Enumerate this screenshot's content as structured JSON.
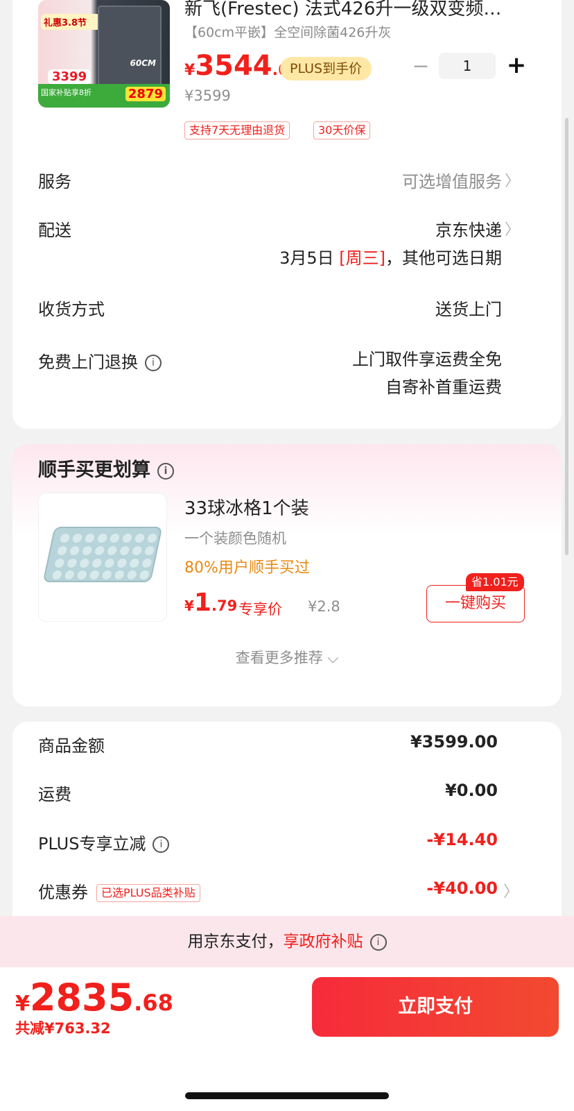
{
  "product": {
    "title": "新飞(Frestec) 法式426升一级双变频…",
    "subtitle": "【60cm平嵌】全空间除菌426升灰",
    "image": {
      "promo_text": "礼惠3.8节",
      "promo_price": "3399",
      "size_text": "60CM",
      "band_text": "国家补贴享8折",
      "band_price": "2879"
    },
    "price_yen": "¥",
    "price_int": "3544",
    "price_dec": ".6",
    "plus_label": "PLUS到手价",
    "orig_price": "¥3599",
    "quantity": "1",
    "minus": "−",
    "plus": "+",
    "badges": [
      "支持7天无理由退货",
      "30天价保"
    ]
  },
  "rows": {
    "service": {
      "label": "服务",
      "value": "可选增值服务"
    },
    "delivery": {
      "label": "配送",
      "value": "京东快递",
      "date_prefix": "3月5日 ",
      "date_day": "[周三]",
      "date_suffix": "，其他可选日期"
    },
    "receive": {
      "label": "收货方式",
      "value": "送货上门"
    },
    "return": {
      "label": "免费上门退换",
      "line1": "上门取件享运费全免",
      "line2": "自寄补首重运费"
    }
  },
  "recommend": {
    "title": "顺手买更划算",
    "item_title": "33球冰格1个装",
    "item_sub": "一个装颜色随机",
    "bought": "80%用户顺手买过",
    "price_yen": "¥",
    "price_int": "1",
    "price_dec": ".79",
    "price_label": "专享价",
    "orig_price": "¥2.8",
    "save_tag": "省1.01元",
    "buy_label": "一键购买",
    "more_label": "查看更多推荐 ⌵"
  },
  "summary": {
    "goods": {
      "label": "商品金额",
      "value": "¥3599.00"
    },
    "shipping": {
      "label": "运费",
      "value": "¥0.00"
    },
    "plus_discount": {
      "label": "PLUS专享立减",
      "value": "-¥14.40"
    },
    "coupon": {
      "label": "优惠券",
      "tag": "已选PLUS品类补贴",
      "value": "-¥40.00"
    }
  },
  "subsidy": {
    "prefix": "用京东支付，",
    "highlight": "享政府补贴"
  },
  "footer": {
    "total_yen": "¥",
    "total_int": "2835",
    "total_dec": ".68",
    "total_saved": "共减¥763.32",
    "pay_label": "立即支付"
  },
  "icons": {
    "info": "info-icon",
    "chevron": "chevron-right-icon"
  },
  "colors": {
    "accent": "#f0201c",
    "plus_gold": "#ffe7a6",
    "orange": "#e88a12"
  }
}
